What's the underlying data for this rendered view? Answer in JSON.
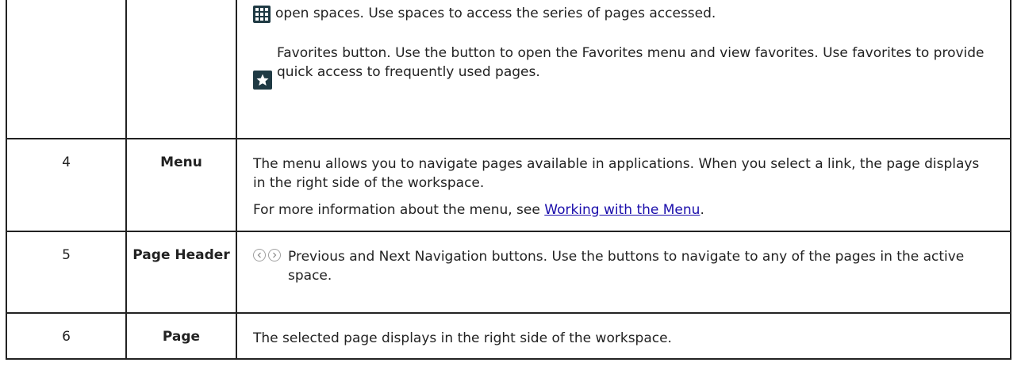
{
  "rows": [
    {
      "num": "",
      "name": "",
      "line_spaces": "open spaces. Use spaces to access the series of pages accessed.",
      "line_favorites": "Favorites button. Use the button to open the Favorites menu and view favorites. Use favorites to provide quick access to frequently used pages.",
      "icons": [
        "grid-icon",
        "star-icon"
      ]
    },
    {
      "num": "4",
      "name": "Menu",
      "text": "The menu allows you to navigate pages available in applications. When you select a link, the page displays in the right side of the workspace.",
      "more_prefix": "For more information about the menu, see ",
      "more_link": "Working with the Menu",
      "more_suffix": "."
    },
    {
      "num": "5",
      "name": "Page Header",
      "text": "Previous and Next Navigation buttons. Use the buttons to navigate to any of the pages in the active space.",
      "icons": [
        "previous-icon",
        "next-icon"
      ]
    },
    {
      "num": "6",
      "name": "Page",
      "text": "The selected page displays in the right side of the workspace."
    }
  ],
  "colors": {
    "icon_bg": "#1f3a44",
    "link": "#1a0dab",
    "border": "#222222"
  }
}
